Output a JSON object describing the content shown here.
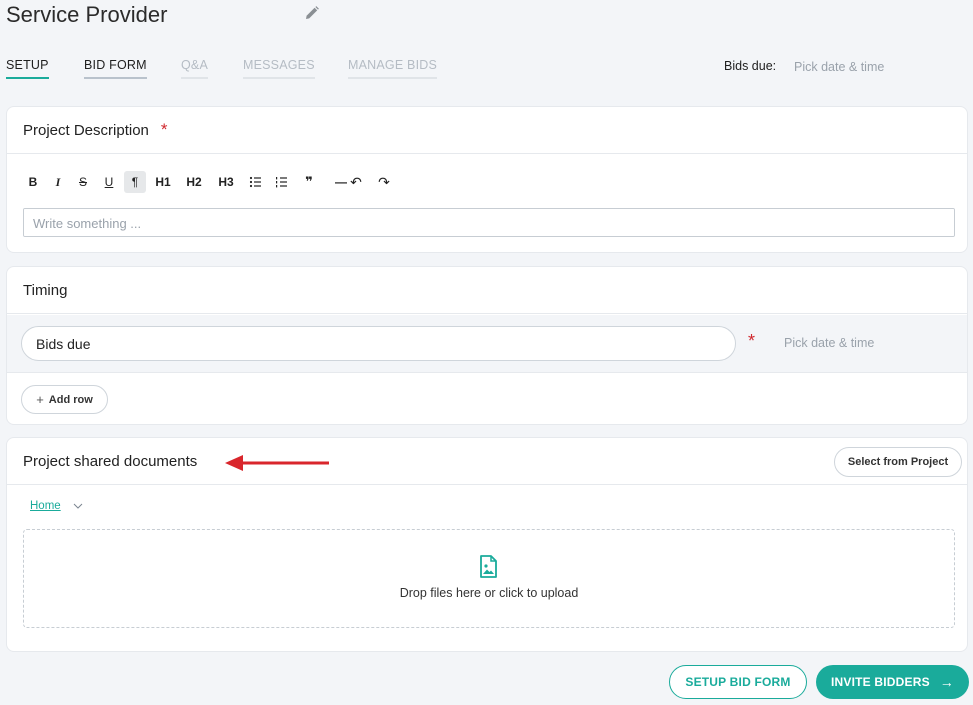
{
  "page": {
    "title": "Service Provider"
  },
  "tabs": [
    {
      "label": "SETUP",
      "state": "active"
    },
    {
      "label": "BID FORM",
      "state": "normal"
    },
    {
      "label": "Q&A",
      "state": "disabled"
    },
    {
      "label": "MESSAGES",
      "state": "disabled"
    },
    {
      "label": "MANAGE BIDS",
      "state": "disabled"
    }
  ],
  "header_bids_due": {
    "label": "Bids due:",
    "value": "Pick date & time"
  },
  "project_description": {
    "title": "Project Description",
    "required_mark": "*",
    "toolbar": {
      "bold": "B",
      "italic": "I",
      "strike": "S",
      "underline": "U",
      "paragraph": "¶",
      "h1": "H1",
      "h2": "H2",
      "h3": "H3",
      "bullet_list_icon": "bullet-list-icon",
      "ordered_list_icon": "ordered-list-icon",
      "quote": "❞",
      "hr": "—",
      "undo": "↶",
      "redo": "↷"
    },
    "editor_placeholder": "Write something ..."
  },
  "timing": {
    "title": "Timing",
    "row": {
      "name": "Bids due",
      "required_mark": "*",
      "date_placeholder": "Pick date & time"
    },
    "add_row": {
      "icon": "+",
      "label": "Add row"
    }
  },
  "shared_documents": {
    "title": "Project shared documents",
    "select_button": "Select from Project",
    "breadcrumb": "Home",
    "dropzone_text": "Drop files here or click to upload"
  },
  "footer": {
    "setup_bid_form": "SETUP BID FORM",
    "invite_bidders": "INVITE BIDDERS",
    "arrow": "→"
  },
  "colors": {
    "accent": "#1aab9b",
    "required": "#d0282e",
    "annotation_arrow": "#d9262c",
    "background": "#f3f5f8"
  }
}
